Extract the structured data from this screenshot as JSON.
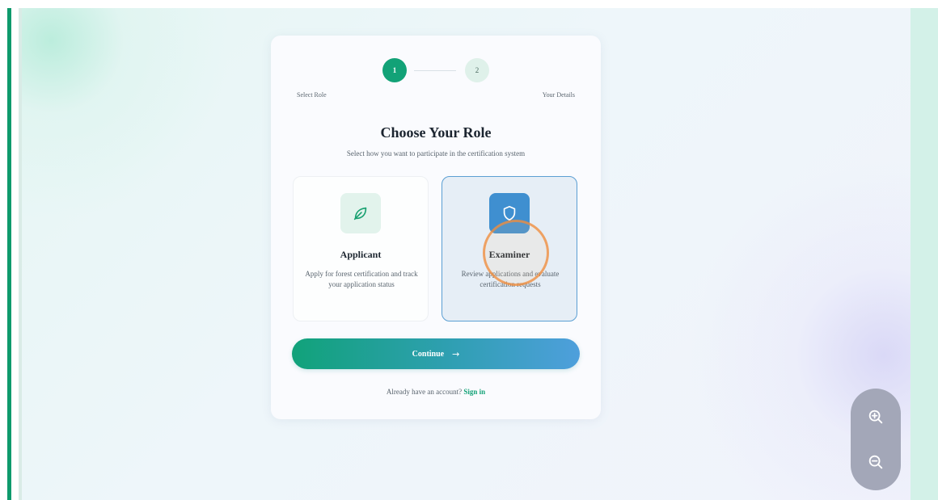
{
  "stepper": {
    "steps": [
      {
        "number": "1",
        "label": "Select Role",
        "state": "active"
      },
      {
        "number": "2",
        "label": "Your Details",
        "state": "pending"
      }
    ]
  },
  "heading": {
    "title": "Choose Your Role",
    "subtitle": "Select how you want to participate in the certification system"
  },
  "roles": [
    {
      "icon": "leaf-icon",
      "title": "Applicant",
      "description": "Apply for forest certification and track your application status",
      "selected": false
    },
    {
      "icon": "shield-icon",
      "title": "Examiner",
      "description": "Review applications and evaluate certification requests",
      "selected": true
    }
  ],
  "continue_button": {
    "label": "Continue",
    "icon": "arrow-right-icon"
  },
  "signin": {
    "prompt": "Already have an account?",
    "link": "Sign in"
  },
  "zoom_controls": {
    "zoom_in_icon": "zoom-in-icon",
    "zoom_out_icon": "zoom-out-icon"
  },
  "colors": {
    "primary_green": "#12a277",
    "selected_border": "#5b9fd3",
    "shield_blue": "#3f8fd0",
    "gradient_start": "#11a27a",
    "gradient_end": "#4e9fdc"
  }
}
